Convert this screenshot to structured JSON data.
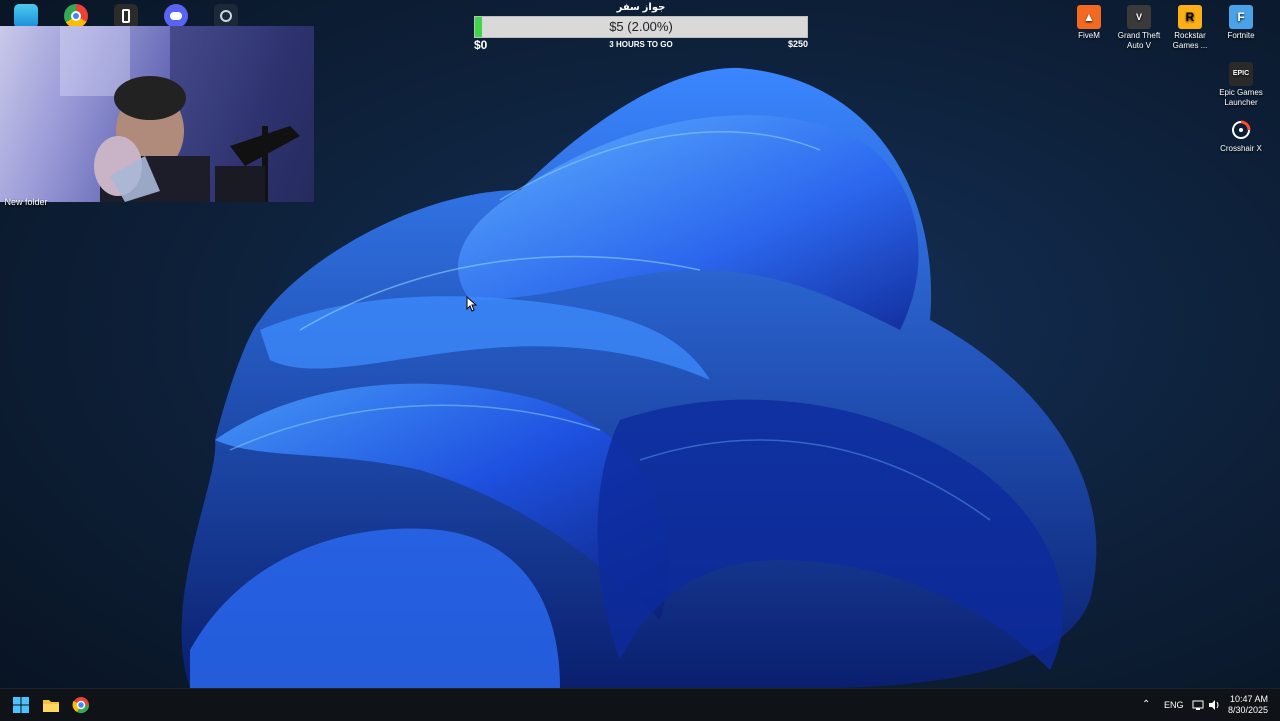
{
  "top_icons": [
    {
      "name": "desktop-icon-monitor"
    },
    {
      "name": "chrome-icon"
    },
    {
      "name": "phone-link-icon"
    },
    {
      "name": "discord-icon"
    },
    {
      "name": "steam-icon"
    }
  ],
  "desktop": {
    "new_folder_label": "New folder",
    "right_icons": [
      {
        "label": "FiveM",
        "icon": "fivem-icon",
        "color": "#f26a21"
      },
      {
        "label": "Grand Theft Auto V",
        "icon": "gta-icon",
        "color": "#3a3a3a"
      },
      {
        "label": "Rockstar Games ...",
        "icon": "rockstar-icon",
        "color": "#fcaf17"
      },
      {
        "label": "Fortnite",
        "icon": "fortnite-icon",
        "color": "#4aa3e8"
      },
      {
        "label": "Epic Games Launcher",
        "icon": "epic-icon",
        "color": "#2a2a2a"
      },
      {
        "label": "Crosshair X",
        "icon": "crosshair-icon",
        "color": "#1a1a1a"
      }
    ]
  },
  "donation_goal": {
    "title": "جواز سفر",
    "amount_text": "$5 (2.00%)",
    "progress_fraction": 0.02,
    "min_label": "$0",
    "time_left": "3 HOURS TO GO",
    "max_label": "$250",
    "fill_color": "#3dd64b"
  },
  "taskbar": {
    "language": "ENG",
    "time": "10:47 AM",
    "date": "8/30/2025"
  }
}
